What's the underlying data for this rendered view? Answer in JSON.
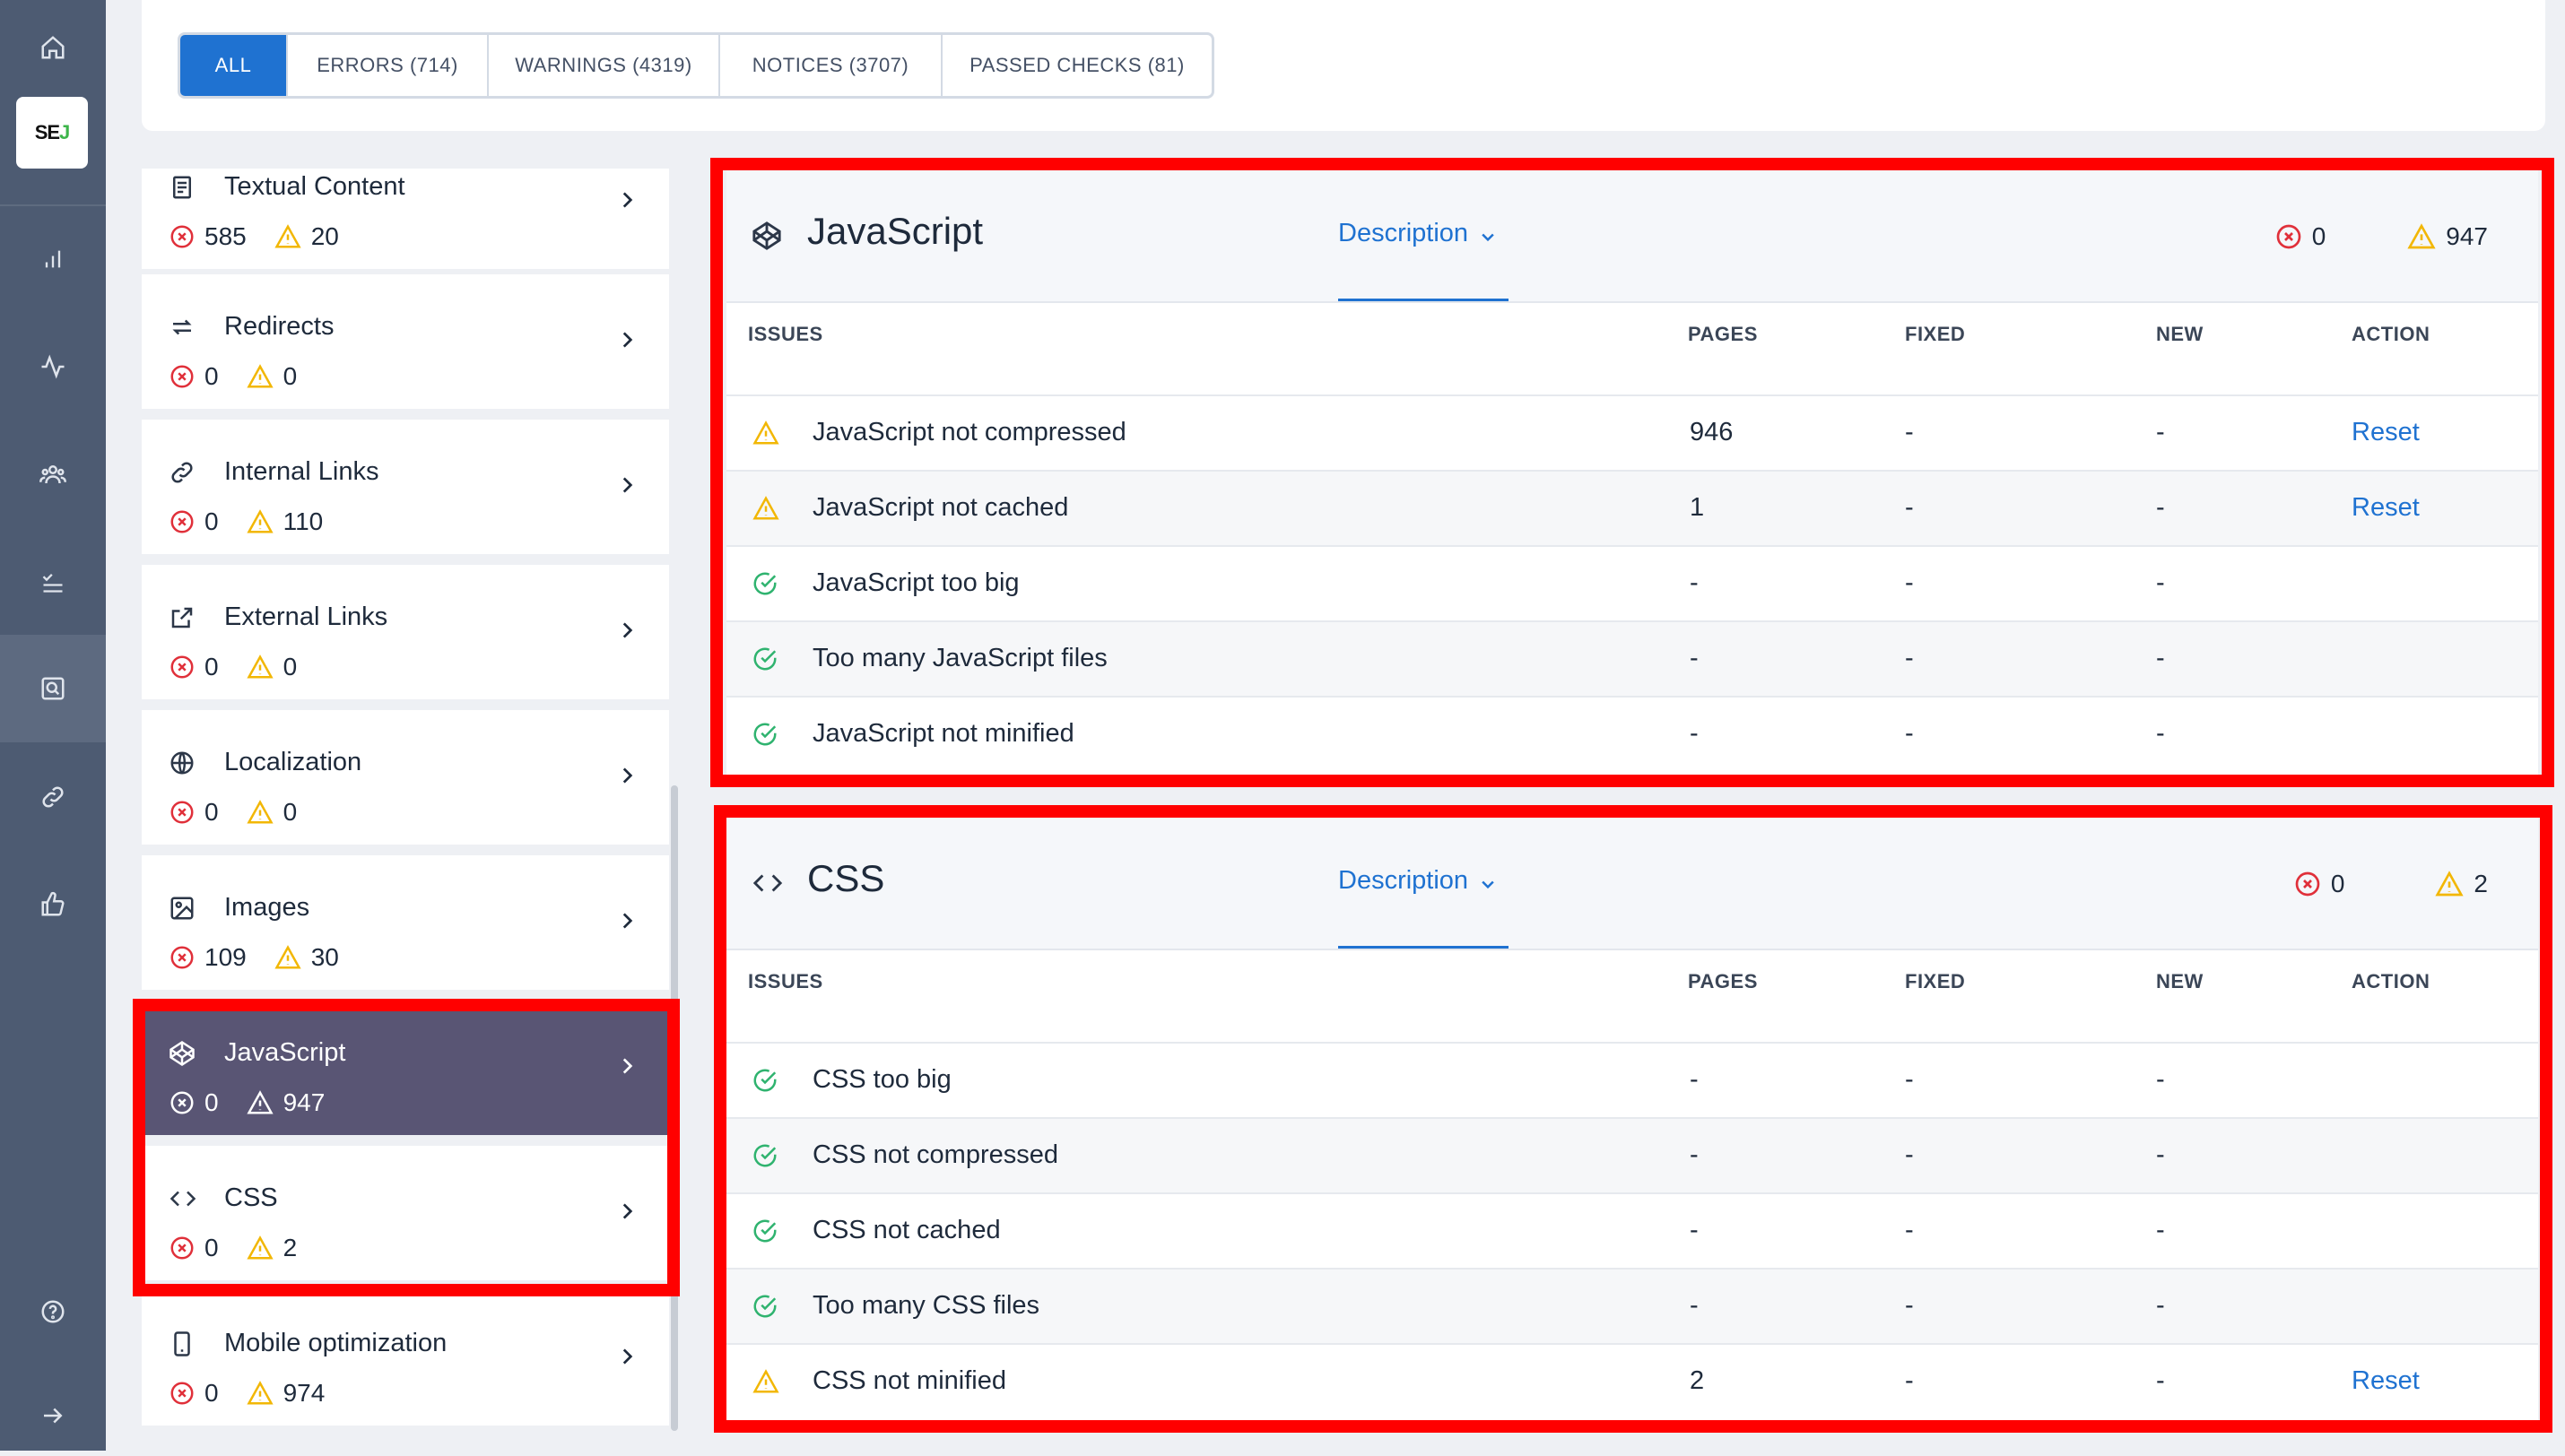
{
  "rail": {
    "logo_text": "SE",
    "logo_accent": "J",
    "icons": [
      "home-icon",
      "bar-chart-icon",
      "pulse-icon",
      "users-icon",
      "checklist-icon",
      "site-audit-icon",
      "link-icon",
      "thumbs-up-icon",
      "help-icon",
      "arrow-right-icon"
    ]
  },
  "filters": [
    {
      "label": "ALL",
      "active": true
    },
    {
      "label": "ERRORS (714)"
    },
    {
      "label": "WARNINGS (4319)"
    },
    {
      "label": "NOTICES (3707)"
    },
    {
      "label": "PASSED CHECKS (81)"
    }
  ],
  "categories": [
    {
      "title": "Textual Content",
      "errors": "585",
      "warnings": "20",
      "icon": "document-icon"
    },
    {
      "title": "Redirects",
      "errors": "0",
      "warnings": "0",
      "icon": "redirect-icon"
    },
    {
      "title": "Internal Links",
      "errors": "0",
      "warnings": "110",
      "icon": "link-icon"
    },
    {
      "title": "External Links",
      "errors": "0",
      "warnings": "0",
      "icon": "external-link-icon"
    },
    {
      "title": "Localization",
      "errors": "0",
      "warnings": "0",
      "icon": "globe-icon"
    },
    {
      "title": "Images",
      "errors": "109",
      "warnings": "30",
      "icon": "image-icon"
    },
    {
      "title": "JavaScript",
      "errors": "0",
      "warnings": "947",
      "icon": "codepen-icon",
      "selected": true
    },
    {
      "title": "CSS",
      "errors": "0",
      "warnings": "2",
      "icon": "code-icon"
    },
    {
      "title": "Mobile optimization",
      "errors": "0",
      "warnings": "974",
      "icon": "mobile-icon"
    }
  ],
  "columns": {
    "issues": "ISSUES",
    "pages": "PAGES",
    "fixed": "FIXED",
    "new": "NEW",
    "action": "ACTION"
  },
  "js_panel": {
    "title": "JavaScript",
    "description_label": "Description",
    "errors": "0",
    "warnings": "947",
    "rows": [
      {
        "status": "warning",
        "issue": "JavaScript not compressed",
        "pages": "946",
        "fixed": "-",
        "new": "-",
        "action": "Reset"
      },
      {
        "status": "warning",
        "issue": "JavaScript not cached",
        "pages": "1",
        "fixed": "-",
        "new": "-",
        "action": "Reset"
      },
      {
        "status": "passed",
        "issue": "JavaScript too big",
        "pages": "-",
        "fixed": "-",
        "new": "-",
        "action": ""
      },
      {
        "status": "passed",
        "issue": "Too many JavaScript files",
        "pages": "-",
        "fixed": "-",
        "new": "-",
        "action": ""
      },
      {
        "status": "passed",
        "issue": "JavaScript not minified",
        "pages": "-",
        "fixed": "-",
        "new": "-",
        "action": ""
      }
    ]
  },
  "css_panel": {
    "title": "CSS",
    "description_label": "Description",
    "errors": "0",
    "warnings": "2",
    "rows": [
      {
        "status": "passed",
        "issue": "CSS too big",
        "pages": "-",
        "fixed": "-",
        "new": "-",
        "action": ""
      },
      {
        "status": "passed",
        "issue": "CSS not compressed",
        "pages": "-",
        "fixed": "-",
        "new": "-",
        "action": ""
      },
      {
        "status": "passed",
        "issue": "CSS not cached",
        "pages": "-",
        "fixed": "-",
        "new": "-",
        "action": ""
      },
      {
        "status": "passed",
        "issue": "Too many CSS files",
        "pages": "-",
        "fixed": "-",
        "new": "-",
        "action": ""
      },
      {
        "status": "warning",
        "issue": "CSS not minified",
        "pages": "2",
        "fixed": "-",
        "new": "-",
        "action": "Reset"
      }
    ]
  },
  "colors": {
    "accent": "#1f72d1",
    "error": "#e0303a",
    "warning": "#f2b705",
    "passed": "#2fb36f",
    "highlight": "#ff0000",
    "selected": "#595574"
  }
}
